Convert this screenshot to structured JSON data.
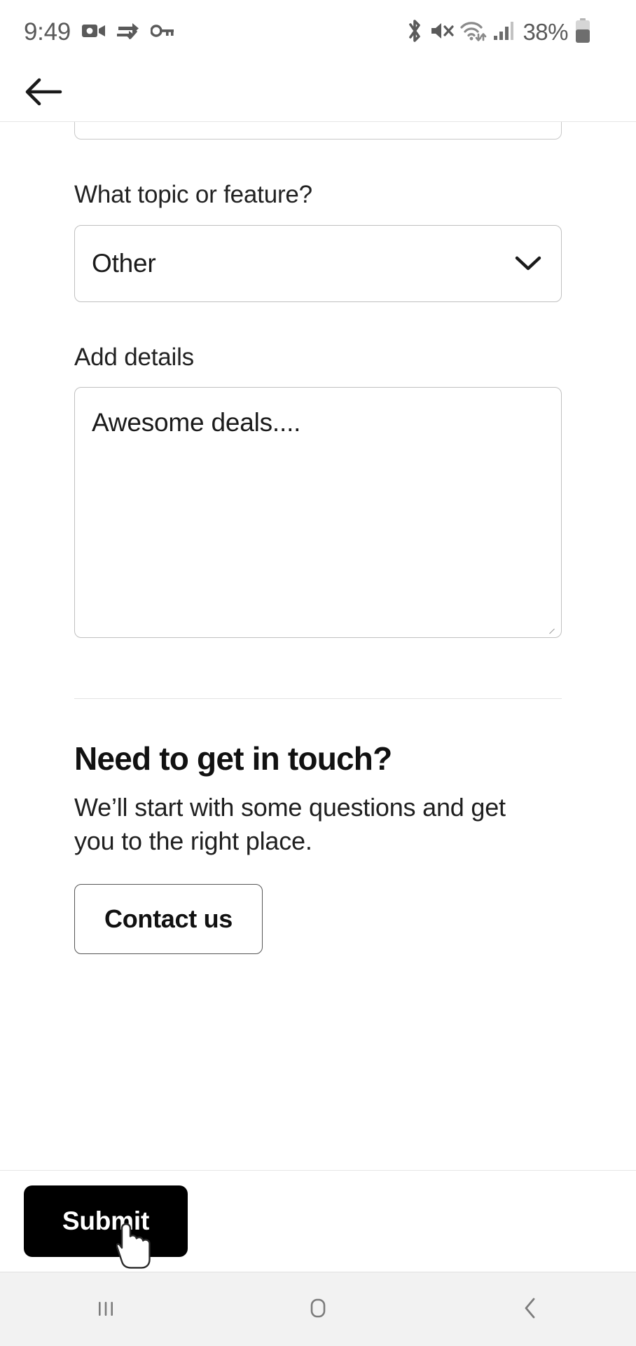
{
  "status_bar": {
    "time": "9:49",
    "battery_percent": "38%",
    "left_icons": [
      "video-camera-icon",
      "data-sync-verified-icon",
      "key-icon"
    ],
    "right_icons": [
      "bluetooth-icon",
      "volume-muted-icon",
      "wifi-icon",
      "cellular-signal-icon",
      "battery-icon"
    ],
    "text_color": "#5a5a5a"
  },
  "header": {
    "back_icon": "back-arrow-icon"
  },
  "form": {
    "topic_label": "What topic or feature?",
    "topic_value": "Other",
    "topic_chevron_icon": "chevron-down-icon",
    "details_label": "Add details",
    "details_value": "Awesome deals....",
    "details_placeholder": "Add details"
  },
  "contact_section": {
    "title": "Need to get in touch?",
    "description": "We’ll start with some questions and get you to the right place.",
    "button_label": "Contact us"
  },
  "action_bar": {
    "submit_label": "Submit",
    "submit_bg": "#000000",
    "submit_text_color": "#ffffff",
    "cursor_icon": "hand-pointer-cursor"
  },
  "nav_bar": {
    "recents_icon": "recents-icon",
    "home_icon": "home-icon",
    "back_icon": "nav-back-icon",
    "background": "#f2f2f2"
  }
}
